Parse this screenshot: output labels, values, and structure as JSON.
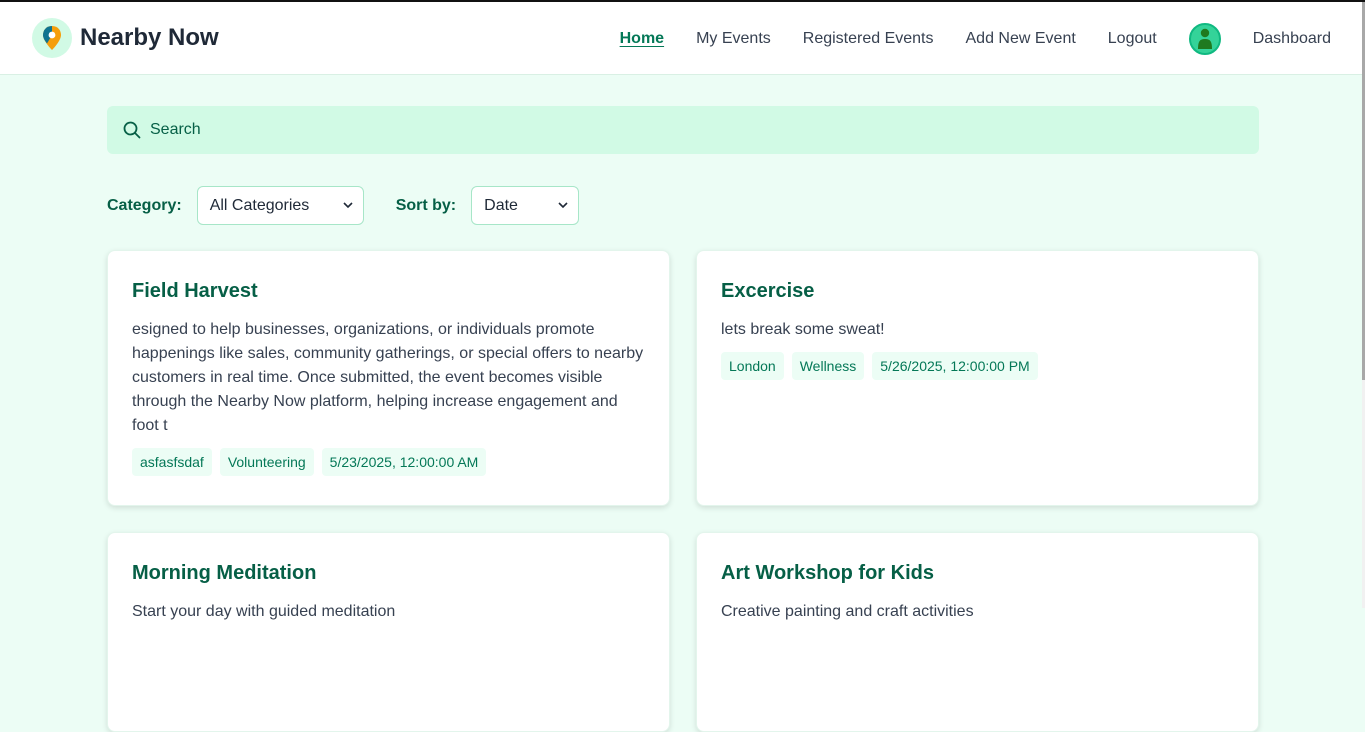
{
  "brand": {
    "name": "Nearby Now"
  },
  "nav": {
    "home": "Home",
    "my_events": "My Events",
    "registered_events": "Registered Events",
    "add_event": "Add New Event",
    "logout": "Logout",
    "dashboard": "Dashboard"
  },
  "search": {
    "placeholder": "Search"
  },
  "filters": {
    "category_label": "Category:",
    "category_value": "All Categories",
    "sort_label": "Sort by:",
    "sort_value": "Date"
  },
  "events": [
    {
      "title": "Field Harvest",
      "description": "esigned to help businesses, organizations, or individuals promote happenings like sales, community gatherings, or special offers to nearby customers in real time. Once submitted, the event becomes visible through the Nearby Now platform, helping increase engagement and foot t",
      "location": "asfasfsdaf",
      "category": "Volunteering",
      "date": "5/23/2025, 12:00:00 AM"
    },
    {
      "title": "Excercise",
      "description": "lets break some sweat!",
      "location": "London",
      "category": "Wellness",
      "date": "5/26/2025, 12:00:00 PM"
    },
    {
      "title": "Morning Meditation",
      "description": "Start your day with guided meditation"
    },
    {
      "title": "Art Workshop for Kids",
      "description": "Creative painting and craft activities"
    }
  ],
  "colors": {
    "accent": "#047857",
    "background": "#ecfdf5",
    "search_bg": "#d1fae5"
  }
}
